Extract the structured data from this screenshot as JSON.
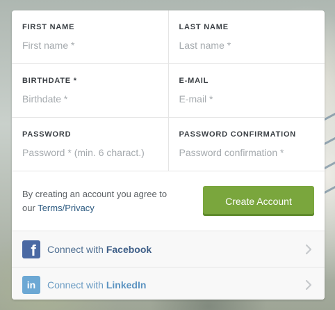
{
  "form": {
    "first_name": {
      "label": "FIRST NAME",
      "placeholder": "First name *"
    },
    "last_name": {
      "label": "LAST NAME",
      "placeholder": "Last name *"
    },
    "birthdate": {
      "label": "BIRTHDATE *",
      "placeholder": "Birthdate *"
    },
    "email": {
      "label": "E-MAIL",
      "placeholder": "E-mail *"
    },
    "password": {
      "label": "PASSWORD",
      "placeholder": "Password * (min. 6 charact.)"
    },
    "password_confirmation": {
      "label": "PASSWORD CONFIRMATION",
      "placeholder": "Password confirmation *"
    }
  },
  "agreement": {
    "text_line1": "By creating an account you agree to",
    "text_prefix": "our",
    "link": "Terms/Privacy"
  },
  "create_button": "Create Account",
  "social": {
    "facebook": {
      "prefix": "Connect with",
      "name": "Facebook",
      "icon": "facebook-icon"
    },
    "linkedin": {
      "prefix": "Connect with",
      "name": "LinkedIn",
      "icon": "linkedin-icon"
    }
  },
  "colors": {
    "accent_green": "#7aa63d",
    "facebook_blue": "#4a69a3",
    "linkedin_blue": "#6ca8d4",
    "link_blue": "#2c5a80"
  }
}
